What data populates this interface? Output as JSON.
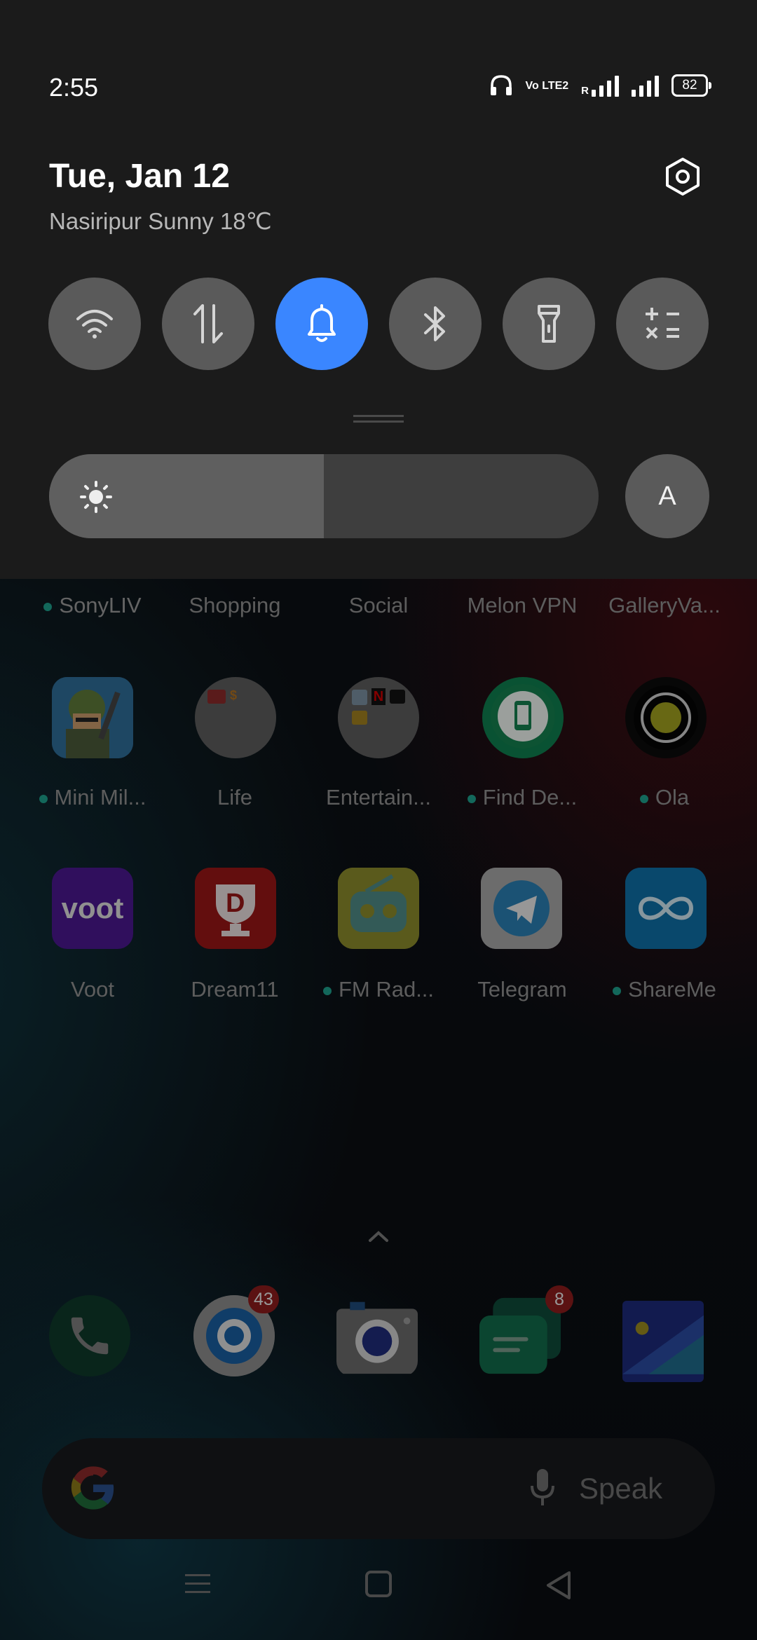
{
  "status_bar": {
    "time": "2:55",
    "volte": "Vo LTE2",
    "roaming": "R",
    "battery": "82"
  },
  "shade": {
    "date": "Tue, Jan 12",
    "weather": "Nasiripur Sunny 18℃",
    "toggles": [
      {
        "name": "wifi-toggle",
        "icon": "wifi-icon",
        "active": false
      },
      {
        "name": "mobile-data-toggle",
        "icon": "data-transfer-icon",
        "active": false
      },
      {
        "name": "sound-toggle",
        "icon": "bell-icon",
        "active": true
      },
      {
        "name": "bluetooth-toggle",
        "icon": "bluetooth-icon",
        "active": false
      },
      {
        "name": "flashlight-toggle",
        "icon": "flashlight-icon",
        "active": false
      },
      {
        "name": "calculator-toggle",
        "icon": "calculator-icon",
        "active": false
      }
    ],
    "brightness_level": 0.5,
    "auto_brightness_label": "A",
    "accent_color": "#3a86ff"
  },
  "home": {
    "row0_labels": [
      "SonyLIV",
      "Shopping",
      "Social",
      "Melon VPN",
      "GalleryVa..."
    ],
    "row1_labels": [
      "Mini Mil...",
      "Life",
      "Entertain...",
      "Find De...",
      "Ola"
    ],
    "row2_labels": [
      "Voot",
      "Dream11",
      "FM Rad...",
      "Telegram",
      "ShareMe"
    ],
    "voot_logo_text": "voot",
    "dream11_logo_text": "D",
    "dock_badges": {
      "browser": "43",
      "messages": "8"
    },
    "search_speak": "Speak"
  }
}
